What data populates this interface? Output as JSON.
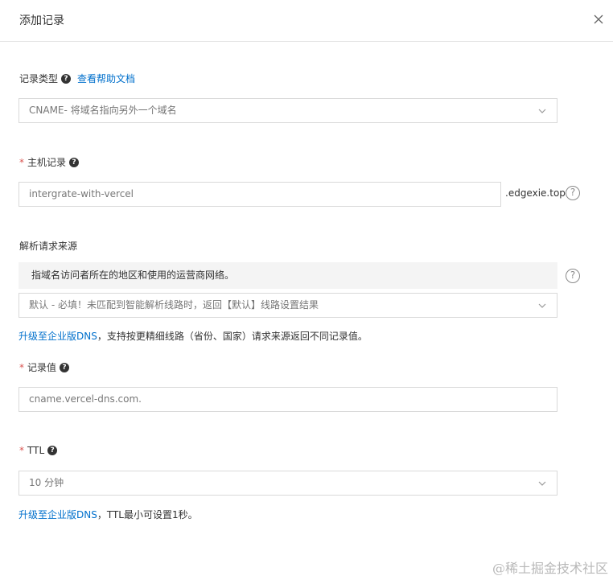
{
  "dialog": {
    "title": "添加记录",
    "close_icon": "close-icon"
  },
  "record_type": {
    "label": "记录类型",
    "help_link": "查看帮助文档",
    "value": "CNAME- 将域名指向另外一个域名"
  },
  "host_record": {
    "required_mark": "*",
    "label": "主机记录",
    "value": "intergrate-with-vercel",
    "suffix": ".edgexie.top"
  },
  "request_source": {
    "label": "解析请求来源",
    "tip": "指域名访问者所在的地区和使用的运营商网络。",
    "value": "默认 - 必填！未匹配到智能解析线路时，返回【默认】线路设置结果",
    "upgrade_link": "升级至企业版DNS",
    "upgrade_text": "，支持按更精细线路（省份、国家）请求来源返回不同记录值。"
  },
  "record_value": {
    "required_mark": "*",
    "label": "记录值",
    "value": "cname.vercel-dns.com."
  },
  "ttl": {
    "required_mark": "*",
    "label": "TTL",
    "value": "10 分钟",
    "upgrade_link": "升级至企业版DNS",
    "upgrade_text": "，TTL最小可设置1秒。"
  },
  "help_symbol": "?",
  "watermark": "@稀土掘金技术社区",
  "colors": {
    "link": "#0070cc",
    "required": "#d9534f",
    "border": "#d9d9d9",
    "tip_bg": "#f4f4f4"
  }
}
